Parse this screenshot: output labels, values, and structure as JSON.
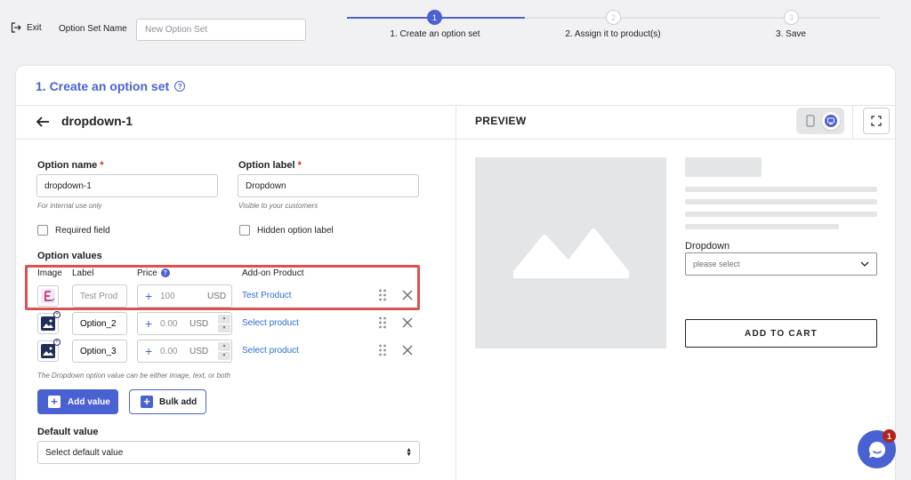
{
  "topbar": {
    "exit_label": "Exit",
    "option_set_name_label": "Option Set Name",
    "option_set_name_placeholder": "New Option Set"
  },
  "steps": [
    {
      "number": "1",
      "label": "1. Create an option set",
      "state": "active"
    },
    {
      "number": "2",
      "label": "2. Assign it to product(s)",
      "state": "inactive"
    },
    {
      "number": "3",
      "label": "3. Save",
      "state": "inactive"
    }
  ],
  "card": {
    "title": "1. Create an option set",
    "option_title": "dropdown-1",
    "preview_title": "PREVIEW"
  },
  "form": {
    "option_name_label": "Option name",
    "option_name_value": "dropdown-1",
    "option_name_hint": "For internal use only",
    "option_label_label": "Option label",
    "option_label_value": "Dropdown",
    "option_label_hint": "Visible to your customers",
    "required_asterisk": "*",
    "required_field_label": "Required field",
    "hidden_label_label": "Hidden option label",
    "option_values_heading": "Option values",
    "columns": {
      "image": "Image",
      "label": "Label",
      "price": "Price",
      "addon": "Add-on Product"
    },
    "price_help": "?",
    "rows": [
      {
        "label_value": "",
        "label_placeholder": "Test Prod",
        "price_placeholder": "100",
        "currency": "USD",
        "addon": "Test Product"
      },
      {
        "label_value": "Option_2",
        "label_placeholder": "",
        "price_placeholder": "0.00",
        "currency": "USD",
        "addon": "Select product"
      },
      {
        "label_value": "Option_3",
        "label_placeholder": "",
        "price_placeholder": "0.00",
        "currency": "USD",
        "addon": "Select product"
      }
    ],
    "values_hint": "The Dropdown option value can be either image, text, or both",
    "add_value_label": "Add value",
    "bulk_add_label": "Bulk add",
    "default_value_label": "Default value",
    "default_value_selected": "Select default value"
  },
  "preview": {
    "dropdown_label": "Dropdown",
    "dropdown_placeholder": "please select",
    "add_to_cart": "ADD TO CART"
  },
  "chat": {
    "badge_count": "1"
  },
  "colors": {
    "accent": "#4a62d1",
    "link": "#2c6ecb",
    "highlight": "#d9534f",
    "required": "#d82c0d"
  }
}
